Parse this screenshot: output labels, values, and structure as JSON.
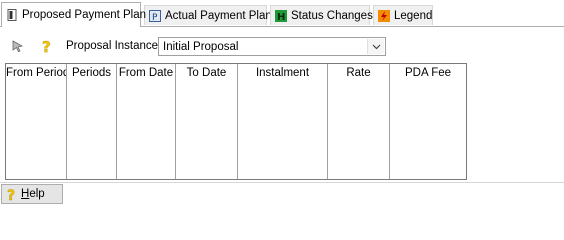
{
  "tabs": [
    {
      "label": "Proposed Payment Plan",
      "icon": "document-icon"
    },
    {
      "label": "Actual Payment Plan",
      "icon": "payment-plan-icon"
    },
    {
      "label": "Status Changes",
      "icon": "status-h-icon"
    },
    {
      "label": "Legend",
      "icon": "legend-icon"
    }
  ],
  "toolbar": {
    "proposal_label": "Proposal Instance:",
    "proposal_value": "Initial Proposal"
  },
  "grid": {
    "columns": [
      "From Period",
      "Periods",
      "From Date",
      "To Date",
      "Instalment",
      "Rate",
      "PDA Fee"
    ]
  },
  "help": {
    "label_prefix": "",
    "label_accel": "H",
    "label_rest": "elp"
  },
  "colors": {
    "help_icon": "#f6c700",
    "status_icon": "#1f9a3a",
    "legend_icon": "#f28c00"
  }
}
